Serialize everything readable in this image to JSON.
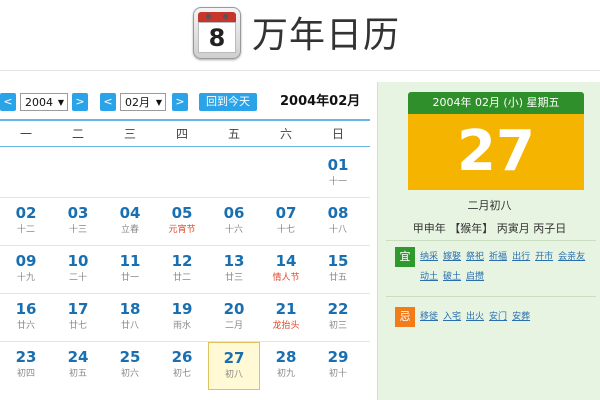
{
  "header": {
    "icon_day": "8",
    "title": "万年日历"
  },
  "toolbar": {
    "prev_label": "<",
    "next_label": ">",
    "year_value": "2004",
    "month_value": "02月",
    "today_label": "回到今天",
    "current_month_title": "2004年02月"
  },
  "weekdays": [
    "一",
    "二",
    "三",
    "四",
    "五",
    "六",
    "日"
  ],
  "days": [
    {
      "num": "01",
      "sub": "十一",
      "red": false
    },
    {
      "num": "02",
      "sub": "十二",
      "red": false
    },
    {
      "num": "03",
      "sub": "十三",
      "red": false
    },
    {
      "num": "04",
      "sub": "立春",
      "red": false
    },
    {
      "num": "05",
      "sub": "元宵节",
      "red": true
    },
    {
      "num": "06",
      "sub": "十六",
      "red": false
    },
    {
      "num": "07",
      "sub": "十七",
      "red": false
    },
    {
      "num": "08",
      "sub": "十八",
      "red": false
    },
    {
      "num": "09",
      "sub": "十九",
      "red": false
    },
    {
      "num": "10",
      "sub": "二十",
      "red": false
    },
    {
      "num": "11",
      "sub": "廿一",
      "red": false
    },
    {
      "num": "12",
      "sub": "廿二",
      "red": false
    },
    {
      "num": "13",
      "sub": "廿三",
      "red": false
    },
    {
      "num": "14",
      "sub": "情人节",
      "red": true
    },
    {
      "num": "15",
      "sub": "廿五",
      "red": false
    },
    {
      "num": "16",
      "sub": "廿六",
      "red": false
    },
    {
      "num": "17",
      "sub": "廿七",
      "red": false
    },
    {
      "num": "18",
      "sub": "廿八",
      "red": false
    },
    {
      "num": "19",
      "sub": "雨水",
      "red": false
    },
    {
      "num": "20",
      "sub": "二月",
      "red": false
    },
    {
      "num": "21",
      "sub": "龙抬头",
      "red": true
    },
    {
      "num": "22",
      "sub": "初三",
      "red": false
    },
    {
      "num": "23",
      "sub": "初四",
      "red": false
    },
    {
      "num": "24",
      "sub": "初五",
      "red": false
    },
    {
      "num": "25",
      "sub": "初六",
      "red": false
    },
    {
      "num": "26",
      "sub": "初七",
      "red": false
    },
    {
      "num": "27",
      "sub": "初八",
      "red": false
    },
    {
      "num": "28",
      "sub": "初九",
      "red": false
    },
    {
      "num": "29",
      "sub": "初十",
      "red": false
    }
  ],
  "first_weekday_index": 6,
  "selected_day": "27",
  "detail": {
    "date_header": "2004年 02月 (小) 星期五",
    "big_day": "27",
    "lunar_date": "二月初八",
    "ganzhi": "甲申年 【猴年】 丙寅月 丙子日",
    "yi_label": "宜",
    "yi_activities": [
      "纳采",
      "嫁娶",
      "祭祀",
      "祈福",
      "出行",
      "开市",
      "会亲友",
      "动土",
      "破土",
      "启攒"
    ],
    "ji_label": "忌",
    "ji_activities": [
      "移徙",
      "入宅",
      "出火",
      "安门",
      "安葬"
    ]
  },
  "colors": {
    "accent_blue": "#2aa3e8",
    "day_number": "#1a6fb0",
    "festival_red": "#e0462a",
    "detail_green": "#2f8f2a",
    "big_day_bg": "#f4b400",
    "yi_badge": "#2e9a2e",
    "ji_badge": "#f27c1a"
  }
}
